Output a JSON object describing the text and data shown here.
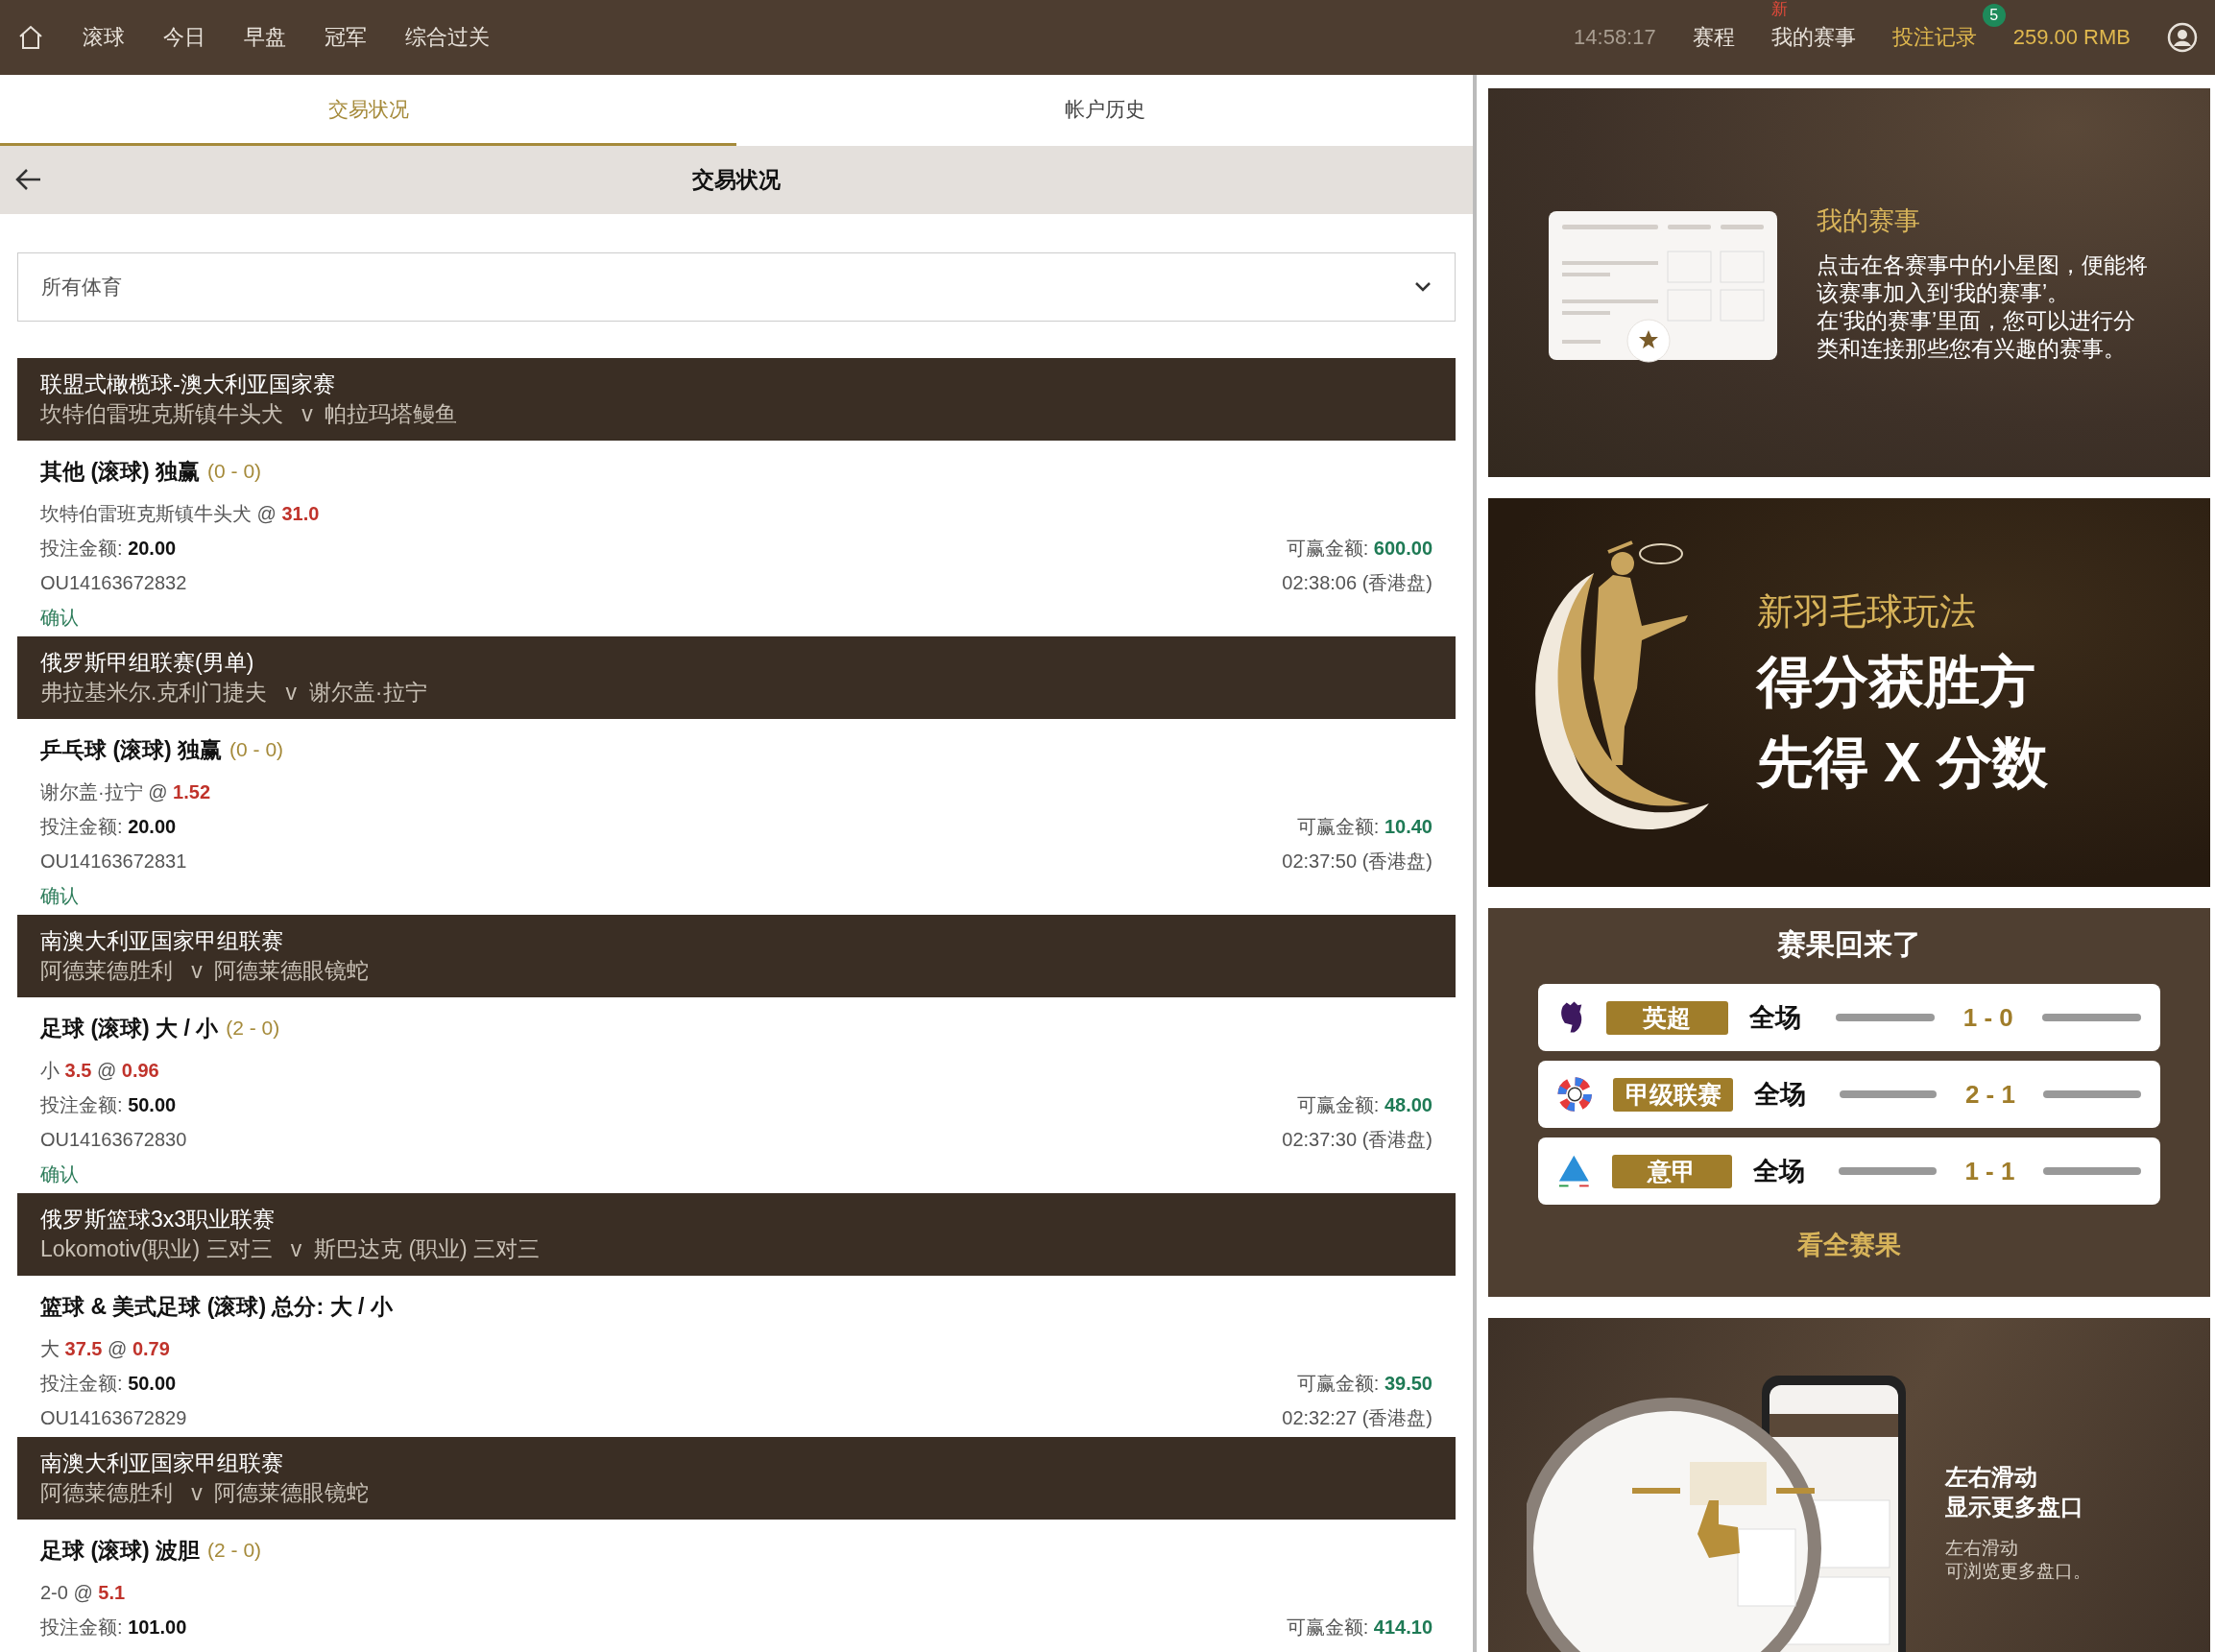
{
  "nav": {
    "items": [
      {
        "label": "滚球"
      },
      {
        "label": "今日"
      },
      {
        "label": "早盘"
      },
      {
        "label": "冠军"
      },
      {
        "label": "综合过关"
      }
    ],
    "clock": "14:58:17",
    "links": [
      {
        "label": "赛程",
        "kind": "plain"
      },
      {
        "label": "我的赛事",
        "kind": "new",
        "tag": "新"
      },
      {
        "label": "投注记录",
        "kind": "count",
        "count": "5"
      }
    ],
    "balance": "259.00 RMB"
  },
  "tabs": [
    {
      "label": "交易状况",
      "selected": true
    },
    {
      "label": "帐户历史",
      "selected": false
    }
  ],
  "header": {
    "title": "交易状况"
  },
  "filter": {
    "value": "所有体育"
  },
  "bets": [
    {
      "league": "联盟式橄榄球-澳大利亚国家赛",
      "home": "坎特伯雷班克斯镇牛头犬",
      "vs": "v",
      "away": "帕拉玛塔鳗鱼",
      "market": "其他 (滚球) 独赢",
      "score": "(0 - 0)",
      "pick": "坎特伯雷班克斯镇牛头犬",
      "at": "@",
      "odds": "31.0",
      "stake_label": "投注金额:",
      "stake": "20.00",
      "win_label": "可赢金额:",
      "win": "600.00",
      "ref": "OU14163672832",
      "time": "02:38:06 (香港盘)",
      "status": "确认"
    },
    {
      "league": "俄罗斯甲组联赛(男单)",
      "home": "弗拉基米尔.克利门捷夫",
      "vs": "v",
      "away": "谢尔盖·拉宁",
      "market": "乒乓球 (滚球) 独赢",
      "score": "(0 - 0)",
      "pick": "谢尔盖·拉宁",
      "at": "@",
      "odds": "1.52",
      "stake_label": "投注金额:",
      "stake": "20.00",
      "win_label": "可赢金额:",
      "win": "10.40",
      "ref": "OU14163672831",
      "time": "02:37:50 (香港盘)",
      "status": "确认"
    },
    {
      "league": "南澳大利亚国家甲组联赛",
      "home": "阿德莱德胜利",
      "vs": "v",
      "away": "阿德莱德眼镜蛇",
      "market": "足球 (滚球) 大 / 小",
      "score": "(2 - 0)",
      "pick": "小",
      "line": "3.5",
      "at": "@",
      "odds": "0.96",
      "stake_label": "投注金额:",
      "stake": "50.00",
      "win_label": "可赢金额:",
      "win": "48.00",
      "ref": "OU14163672830",
      "time": "02:37:30 (香港盘)",
      "status": "确认"
    },
    {
      "league": "俄罗斯篮球3x3职业联赛",
      "home": "Lokomotiv(职业) 三对三",
      "vs": "v",
      "away": "斯巴达克 (职业) 三对三",
      "market": "篮球 & 美式足球 (滚球) 总分: 大 / 小",
      "pick": "大",
      "line": "37.5",
      "at": "@",
      "odds": "0.79",
      "stake_label": "投注金额:",
      "stake": "50.00",
      "win_label": "可赢金额:",
      "win": "39.50",
      "ref": "OU14163672829",
      "time": "02:32:27 (香港盘)"
    },
    {
      "league": "南澳大利亚国家甲组联赛",
      "home": "阿德莱德胜利",
      "vs": "v",
      "away": "阿德莱德眼镜蛇",
      "market": "足球 (滚球) 波胆",
      "score": "(2 - 0)",
      "pick": "2-0",
      "at": "@",
      "odds": "5.1",
      "stake_label": "投注金额:",
      "stake": "101.00",
      "win_label": "可赢金额:",
      "win": "414.10"
    }
  ],
  "promo_my_matches": {
    "title": "我的赛事",
    "paragraphs": [
      "点击在各赛事中的小星图，便能将该赛事加入到‘我的赛事’。",
      "在‘我的赛事’里面，您可以进行分类和连接那些您有兴趣的赛事。"
    ]
  },
  "promo_badminton": {
    "subtitle": "新羽毛球玩法",
    "lines": [
      "得分获胜方",
      "先得 X 分数"
    ]
  },
  "results": {
    "title": "赛果回来了",
    "rows": [
      {
        "kind": "lion",
        "league": "英超",
        "period": "全场",
        "score": "1 - 0"
      },
      {
        "kind": "ring",
        "league": "甲级联赛",
        "period": "全场",
        "score": "2 - 1"
      },
      {
        "kind": "pyramid",
        "league": "意甲",
        "period": "全场",
        "score": "1 - 1"
      }
    ],
    "link": "看全赛果"
  },
  "promo_swipe": {
    "title_lines": [
      "左右滑动",
      "显示更多盘口"
    ],
    "sub_lines": [
      "左右滑动",
      "可浏览更多盘口。"
    ]
  }
}
